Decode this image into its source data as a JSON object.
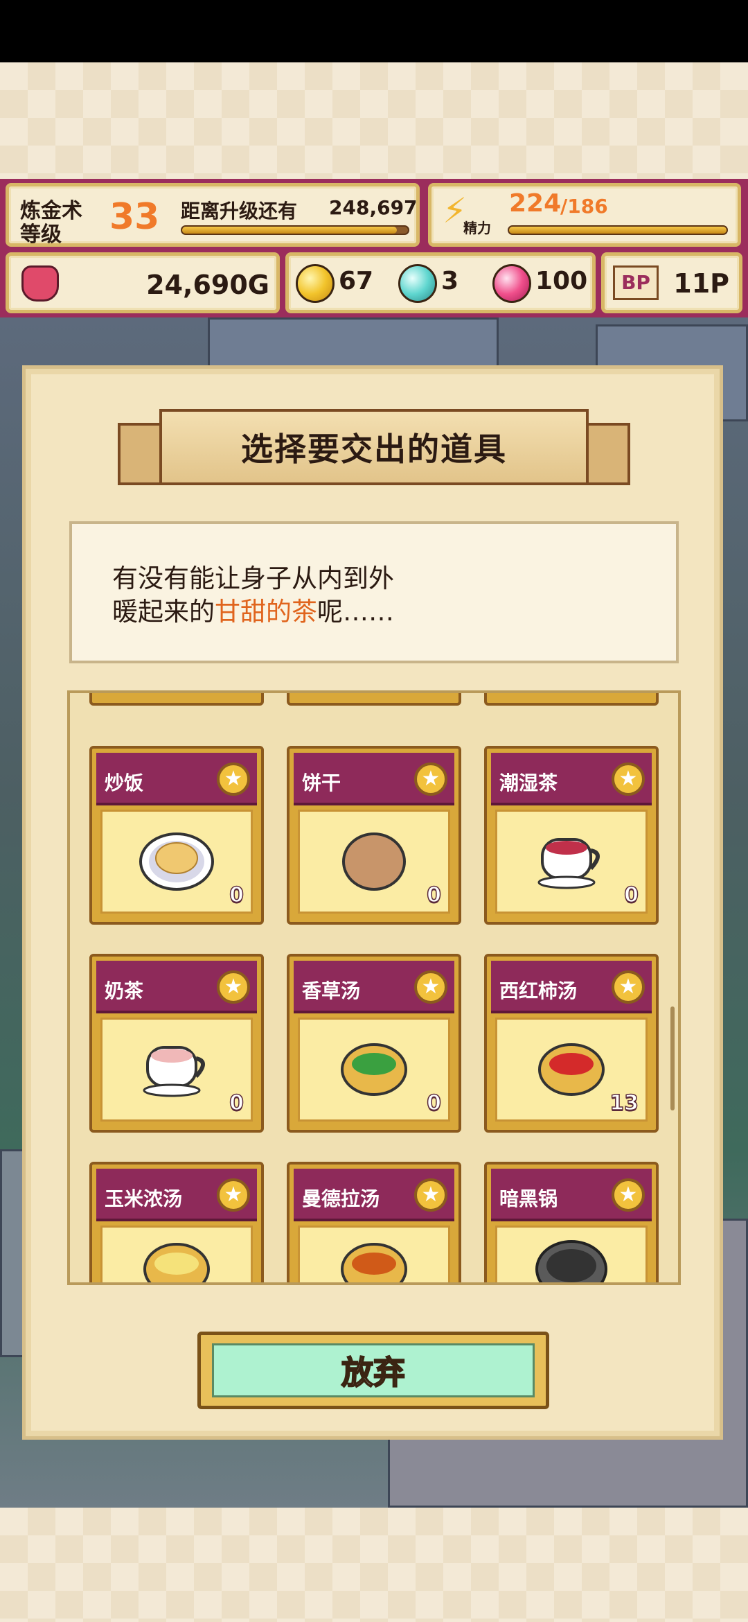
{
  "hud": {
    "alchemy_label_line1": "炼金术",
    "alchemy_label_line2": "等级",
    "level": "33",
    "next_level_label": "距离升级还有",
    "next_level_value": "248,697",
    "energy_label": "精力",
    "energy_current": "224",
    "energy_max": "/186",
    "gold": "24,690G",
    "orb_yellow": "67",
    "orb_blue": "3",
    "orb_pink": "100",
    "bp_icon": "BP",
    "bp_value": "11P",
    "exp_progress": 0.95,
    "energy_progress": 1.0
  },
  "colors": {
    "accent": "#9b2d5c",
    "highlight": "#e0641d",
    "button": "#aef2d0"
  },
  "dialog": {
    "title": "选择要交出的道具",
    "request_line1": "有没有能让身子从内到外",
    "request_line2_prefix": "暖起来的",
    "request_line2_highlight": "甘甜的茶",
    "request_line2_suffix": "呢……"
  },
  "items": [
    {
      "name": "炒饭",
      "count": "0",
      "icon": "fried-rice-icon"
    },
    {
      "name": "饼干",
      "count": "0",
      "icon": "cookie-icon"
    },
    {
      "name": "潮湿茶",
      "count": "0",
      "icon": "tea-cup-icon"
    },
    {
      "name": "奶茶",
      "count": "0",
      "icon": "milk-tea-icon"
    },
    {
      "name": "香草汤",
      "count": "0",
      "icon": "herb-soup-icon"
    },
    {
      "name": "西红柿汤",
      "count": "13",
      "icon": "tomato-soup-icon"
    },
    {
      "name": "玉米浓汤",
      "count": "",
      "icon": "corn-soup-icon"
    },
    {
      "name": "曼德拉汤",
      "count": "",
      "icon": "mandrake-soup-icon"
    },
    {
      "name": "暗黑锅",
      "count": "",
      "icon": "dark-pot-icon"
    }
  ],
  "actions": {
    "give_up": "放弃"
  }
}
